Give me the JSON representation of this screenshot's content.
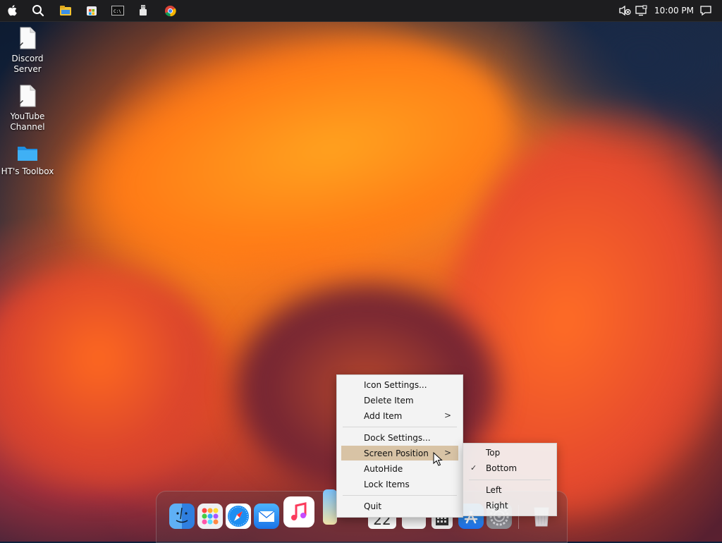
{
  "topbar": {
    "clock": "10:00 PM",
    "left_icons": [
      "apple-icon",
      "search-icon",
      "file-explorer-icon",
      "microsoft-store-icon",
      "terminal-icon",
      "usb-drive-icon",
      "chrome-icon"
    ],
    "right_icons": [
      "mute-icon",
      "screen-icon",
      "notification-icon"
    ]
  },
  "desktop": {
    "icons": [
      {
        "name": "file-icon",
        "label_line1": "Discord",
        "label_line2": "Server"
      },
      {
        "name": "file-icon",
        "label_line1": "YouTube",
        "label_line2": "Channel"
      },
      {
        "name": "folder-icon",
        "label_line1": "HT's Toolbox",
        "label_line2": ""
      }
    ]
  },
  "dock": {
    "apps": [
      "finder",
      "launchpad",
      "safari",
      "mail",
      "music",
      "maps",
      "calendar",
      "notes",
      "keyboard-viewer",
      "app-store",
      "system-preferences",
      "trash"
    ],
    "calendar_day": "22"
  },
  "context_menu": {
    "items": [
      {
        "label": "Icon Settings...",
        "submenu": false
      },
      {
        "label": "Delete Item",
        "submenu": false
      },
      {
        "label": "Add Item",
        "submenu": true
      },
      {
        "label": "Dock Settings...",
        "submenu": false
      },
      {
        "label": "Screen Position",
        "submenu": true,
        "highlighted": true
      },
      {
        "label": "AutoHide",
        "submenu": false
      },
      {
        "label": "Lock Items",
        "submenu": false
      },
      {
        "label": "Quit",
        "submenu": false
      }
    ],
    "chevron": ">"
  },
  "screen_position_submenu": {
    "items": [
      {
        "label": "Top",
        "checked": false
      },
      {
        "label": "Bottom",
        "checked": true
      },
      {
        "label": "Left",
        "checked": false
      },
      {
        "label": "Right",
        "checked": false
      }
    ],
    "check_glyph": "✓"
  },
  "colors": {
    "menu_bg": "#f3f3f3",
    "menu_highlight": "#d8c3a5",
    "topbar_bg": "#1d1d1f"
  }
}
